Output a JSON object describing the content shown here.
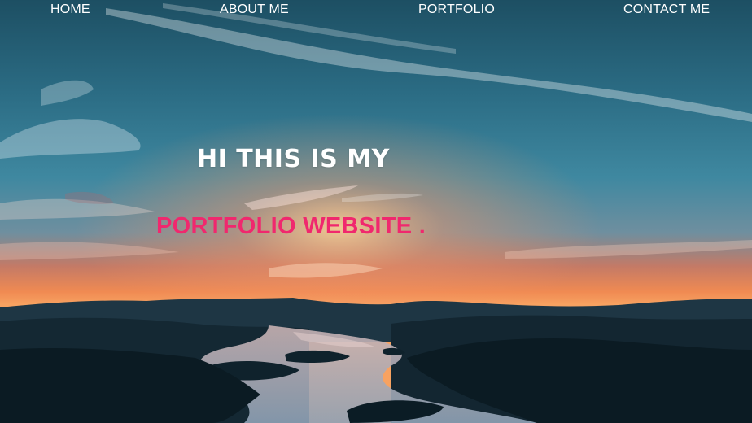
{
  "nav": {
    "items": [
      {
        "label": "HOME"
      },
      {
        "label": "ABOUT ME"
      },
      {
        "label": "PORTFOLIO"
      },
      {
        "label": "CONTACT ME"
      }
    ]
  },
  "hero": {
    "title": "HI THIS IS MY",
    "subtitle": "PORTFOLIO WEBSITE .",
    "title_color": "#ffffff",
    "subtitle_color": "#f0286e",
    "background": "sunset sky over mountain lake at dusk"
  }
}
